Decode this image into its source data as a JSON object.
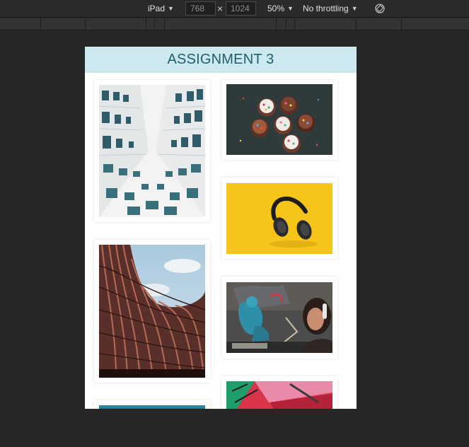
{
  "toolbar": {
    "device": "iPad",
    "width_value": "768",
    "height_value": "1024",
    "dimension_separator": "×",
    "zoom": "50%",
    "throttling": "No throttling"
  },
  "page": {
    "title": "ASSIGNMENT 3"
  },
  "gallery": {
    "left_column": [
      {
        "subject": "building-looking-up"
      },
      {
        "subject": "wavy-building-facade"
      },
      {
        "subject": "blue-photo-partial"
      }
    ],
    "right_column": [
      {
        "subject": "cupcakes"
      },
      {
        "subject": "headphones-on-yellow"
      },
      {
        "subject": "graffiti-and-woman"
      },
      {
        "subject": "colorful-graffiti-partial"
      }
    ]
  },
  "colors": {
    "heading_background": "#cbe9ee",
    "heading_text": "#1f5f6b",
    "canvas_background": "#262626"
  }
}
